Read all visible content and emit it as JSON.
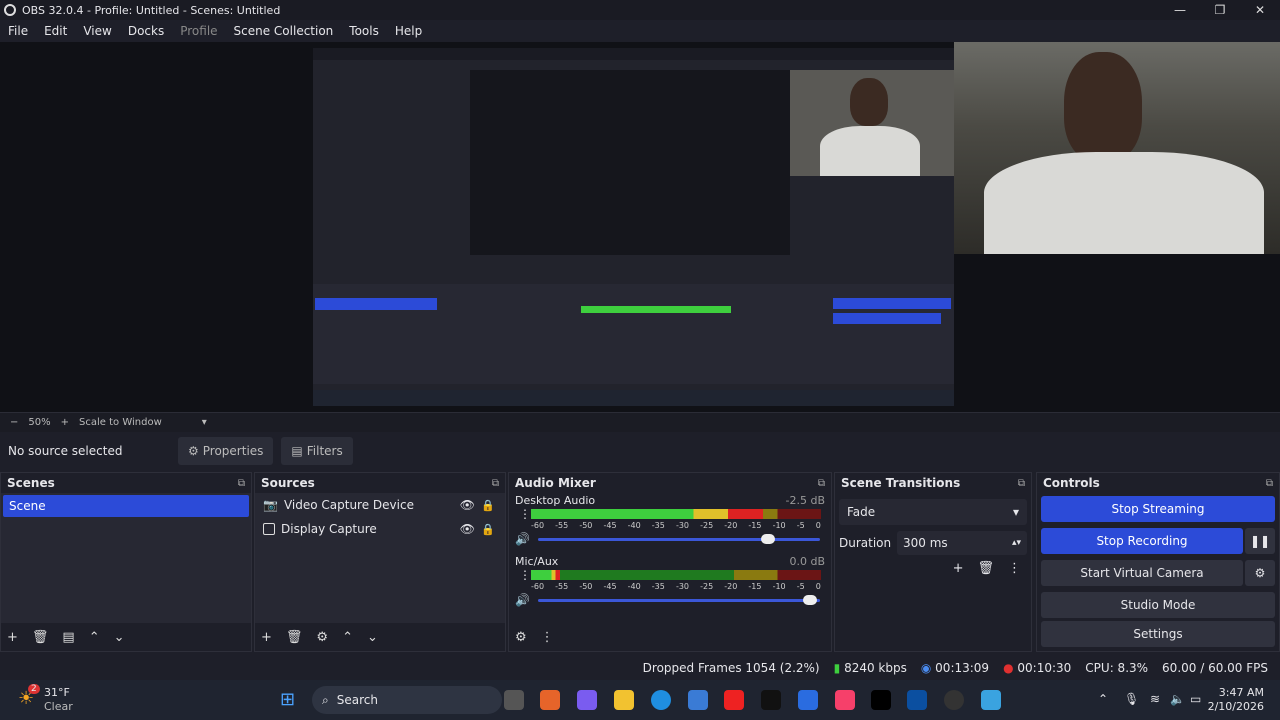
{
  "window": {
    "title": "OBS 32.0.4 - Profile: Untitled - Scenes: Untitled"
  },
  "menu": {
    "file": "File",
    "edit": "Edit",
    "view": "View",
    "docks": "Docks",
    "profile": "Profile",
    "scene_collection": "Scene Collection",
    "tools": "Tools",
    "help": "Help"
  },
  "preview": {
    "zoom": "50%",
    "scale_mode": "Scale to Window"
  },
  "source_toolbar": {
    "no_source": "No source selected",
    "properties": "Properties",
    "filters": "Filters"
  },
  "scenes": {
    "title": "Scenes",
    "items": [
      "Scene"
    ]
  },
  "sources": {
    "title": "Sources",
    "items": [
      "Video Capture Device",
      "Display Capture"
    ]
  },
  "mixer": {
    "title": "Audio Mixer",
    "channels": [
      {
        "name": "Desktop Audio",
        "db": "-2.5 dB",
        "level": 0.8,
        "volume": 0.84
      },
      {
        "name": "Mic/Aux",
        "db": "0.0 dB",
        "level": 0.1,
        "volume": 0.99
      }
    ],
    "ticks": [
      "-60",
      "-55",
      "-50",
      "-45",
      "-40",
      "-35",
      "-30",
      "-25",
      "-20",
      "-15",
      "-10",
      "-5",
      "0"
    ]
  },
  "transitions": {
    "title": "Scene Transitions",
    "type": "Fade",
    "duration_label": "Duration",
    "duration": "300 ms"
  },
  "controls": {
    "title": "Controls",
    "stop_streaming": "Stop Streaming",
    "stop_recording": "Stop Recording",
    "start_virtual_camera": "Start Virtual Camera",
    "studio_mode": "Studio Mode",
    "settings": "Settings"
  },
  "status": {
    "dropped": "Dropped Frames 1054 (2.2%)",
    "bitrate": "8240 kbps",
    "stream_time": "00:13:09",
    "rec_time": "00:10:30",
    "cpu": "CPU: 8.3%",
    "fps": "60.00 / 60.00 FPS"
  },
  "taskbar": {
    "temp": "31°F",
    "weather": "Clear",
    "badge": "2",
    "search": "Search",
    "time": "3:47 AM",
    "date": "2/10/2026"
  },
  "colors": {
    "accent": "#2c4bd8",
    "bg": "#1e1f29",
    "panel": "#272833"
  }
}
